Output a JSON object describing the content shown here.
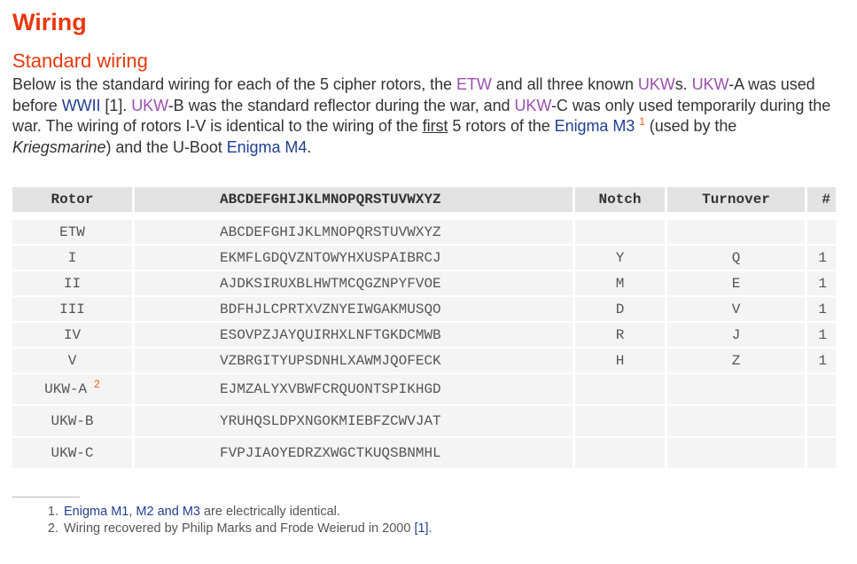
{
  "title": "Wiring",
  "section_title": "Standard wiring",
  "intro": {
    "t1": "Below is the standard wiring for each of the 5 cipher rotors, the ",
    "etw": "ETW",
    "t2": " and all three known ",
    "ukws": "UKW",
    "t3": "s. ",
    "ukwa": "UKW",
    "t4": "-A was used before ",
    "wwii": "WWII",
    "t5": " [1]. ",
    "ukwb": "UKW",
    "t6": "-B was the standard reflector during the war, and ",
    "ukwc": "UKW",
    "t7": "-C was only used temporarily during the war. The wiring of rotors I-V is identical to the wiring of the ",
    "first": "first",
    "t8": " 5 rotors of the ",
    "enigma_m3": "Enigma M3",
    "sup1": "1",
    "t9": " (used by the ",
    "kriegsmarine": "Kriegsmarine",
    "t10": ") and the U-Boot ",
    "enigma_m4": "Enigma M4",
    "t11": "."
  },
  "table": {
    "headers": {
      "rotor": "Rotor",
      "wiring": "ABCDEFGHIJKLMNOPQRSTUVWXYZ",
      "notch": "Notch",
      "turnover": "Turnover",
      "num": "#"
    },
    "rows": [
      {
        "rotor": "ETW",
        "sup": "",
        "wiring": "ABCDEFGHIJKLMNOPQRSTUVWXYZ",
        "notch": "",
        "turnover": "",
        "num": ""
      },
      {
        "rotor": "I",
        "sup": "",
        "wiring": "EKMFLGDQVZNTOWYHXUSPAIBRCJ",
        "notch": "Y",
        "turnover": "Q",
        "num": "1"
      },
      {
        "rotor": "II",
        "sup": "",
        "wiring": "AJDKSIRUXBLHWTMCQGZNPYFVOE",
        "notch": "M",
        "turnover": "E",
        "num": "1"
      },
      {
        "rotor": "III",
        "sup": "",
        "wiring": "BDFHJLCPRTXVZNYEIWGAKMUSQO",
        "notch": "D",
        "turnover": "V",
        "num": "1"
      },
      {
        "rotor": "IV",
        "sup": "",
        "wiring": "ESOVPZJAYQUIRHXLNFTGKDCMWB",
        "notch": "R",
        "turnover": "J",
        "num": "1"
      },
      {
        "rotor": "V",
        "sup": "",
        "wiring": "VZBRGITYUPSDNHLXAWMJQOFECK",
        "notch": "H",
        "turnover": "Z",
        "num": "1"
      },
      {
        "rotor": "UKW-A",
        "sup": "2",
        "wiring": "EJMZALYXVBWFCRQUONTSPIKHGD",
        "notch": "",
        "turnover": "",
        "num": ""
      },
      {
        "rotor": "UKW-B",
        "sup": "",
        "wiring": "YRUHQSLDPXNGOKMIEBFZCWVJAT",
        "notch": "",
        "turnover": "",
        "num": ""
      },
      {
        "rotor": "UKW-C",
        "sup": "",
        "wiring": "FVPJIAOYEDRZXWGCTKUQSBNMHL",
        "notch": "",
        "turnover": "",
        "num": ""
      }
    ]
  },
  "footnotes": {
    "fn1": {
      "enigma": "Enigma",
      "m1": "M1",
      "sep1": ", ",
      "m2m3": "M2 and M3",
      "rest": " are electrically identical."
    },
    "fn2": {
      "text": "Wiring recovered by Philip Marks and Frode Weierud in 2000 ",
      "ref": "[1]",
      "end": "."
    }
  },
  "colors": {
    "heading": "#e8380d",
    "link_purple": "#9c4fae",
    "link_navy": "#1f3f91",
    "header_bg": "#e3e3e3",
    "row_bg": "#f4f4f4"
  }
}
